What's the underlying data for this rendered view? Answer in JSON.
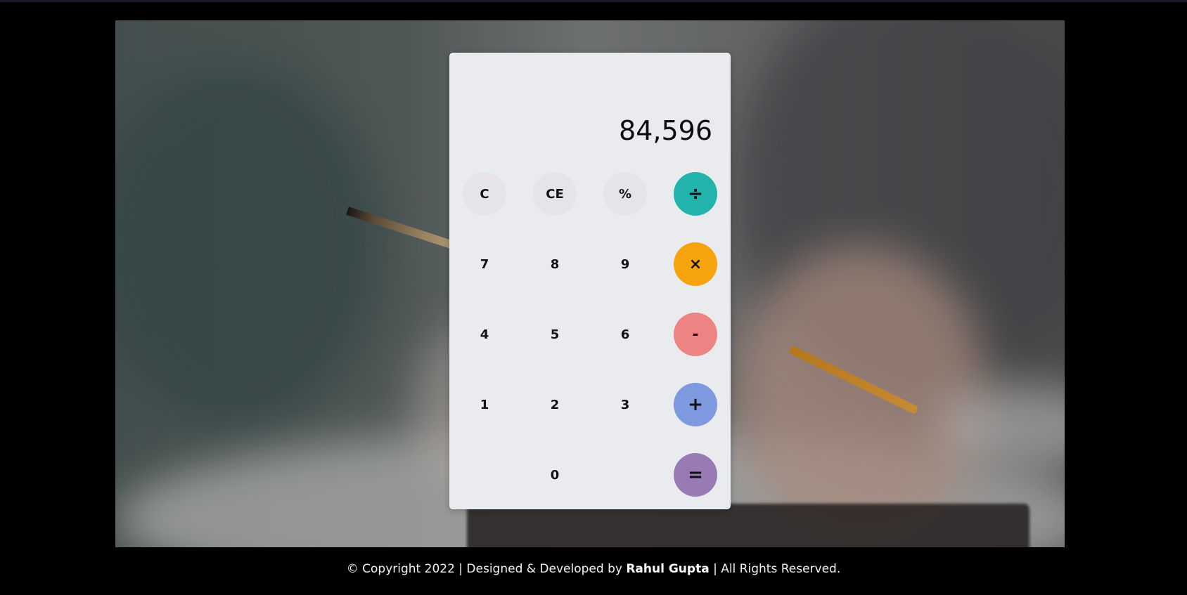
{
  "calculator": {
    "display": "84,596",
    "buttons": {
      "clear": "C",
      "clear_entry": "CE",
      "percent": "%",
      "divide": "÷",
      "seven": "7",
      "eight": "8",
      "nine": "9",
      "multiply": "×",
      "four": "4",
      "five": "5",
      "six": "6",
      "subtract": "-",
      "one": "1",
      "two": "2",
      "three": "3",
      "add": "+",
      "zero": "0",
      "equals": "="
    }
  },
  "colors": {
    "divide": "#22b3ac",
    "multiply": "#f7a30e",
    "subtract": "#ee8383",
    "add": "#7f99e0",
    "equals": "#987ab5",
    "function_keys": "#e6e4e8",
    "calculator_panel": "#e9ebee"
  },
  "footer": {
    "prefix": "© Copyright 2022 | Designed & Developed by ",
    "author": "Rahul Gupta",
    "suffix": " | All Rights Reserved."
  }
}
